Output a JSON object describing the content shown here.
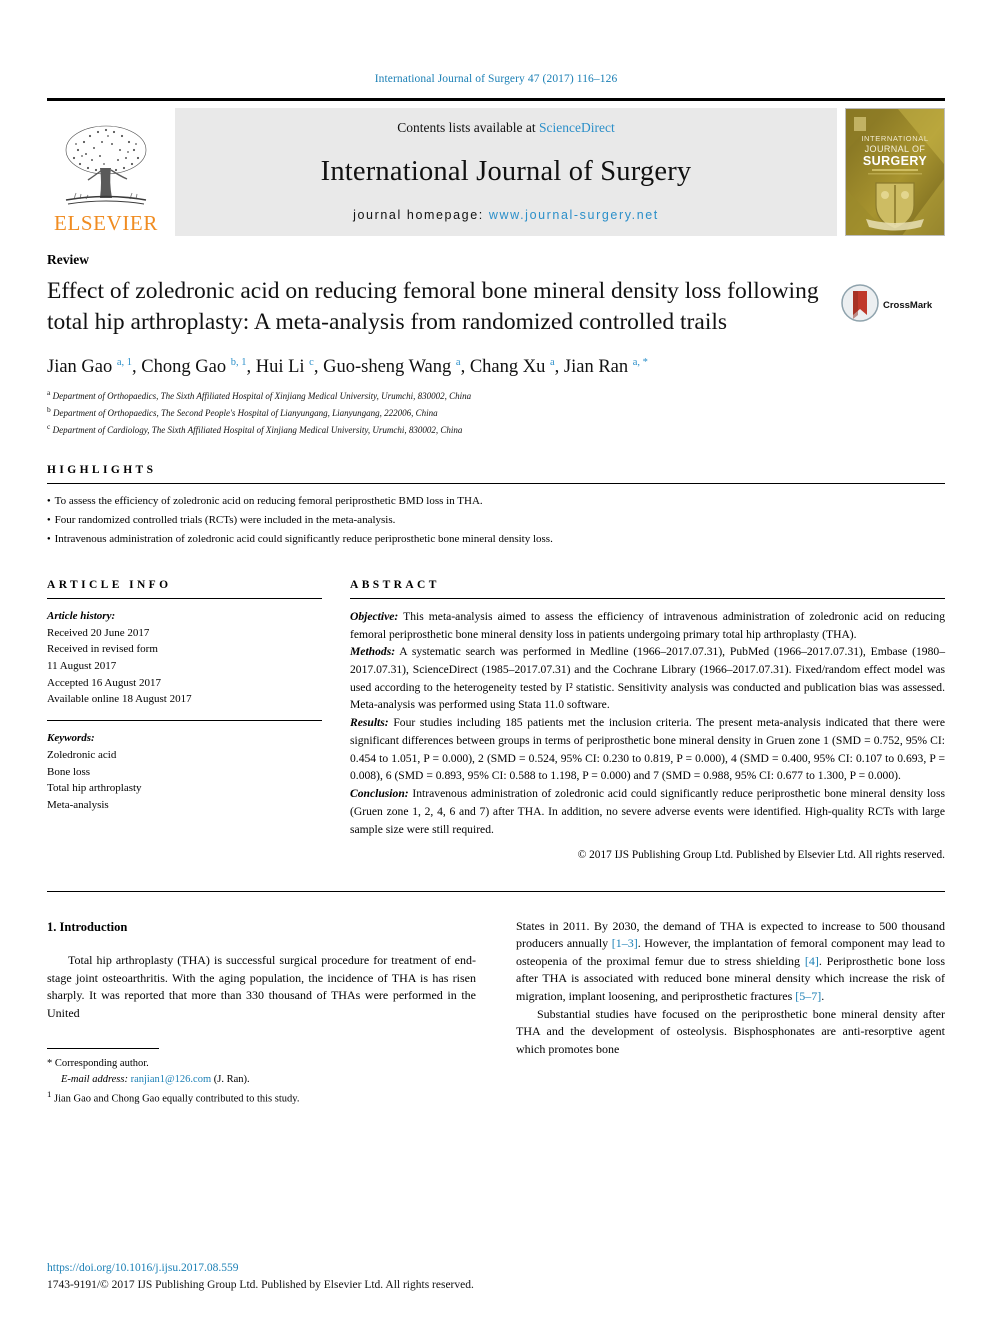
{
  "running_head": "International Journal of Surgery 47 (2017) 116–126",
  "masthead": {
    "publisher": "ELSEVIER",
    "contents_prefix": "Contents lists available at ",
    "contents_link": "ScienceDirect",
    "journal_name": "International Journal of Surgery",
    "homepage_label": "journal homepage: ",
    "homepage_url": "www.journal-surgery.net",
    "cover_line1": "INTERNATIONAL",
    "cover_line2": "JOURNAL OF",
    "cover_line3": "SURGERY"
  },
  "article": {
    "type": "Review",
    "title": "Effect of zoledronic acid on reducing femoral bone mineral density loss following total hip arthroplasty: A meta-analysis from randomized controlled trails",
    "crossmark_label": "CrossMark",
    "authors_html": "Jian Gao <sup>a, 1</sup>, Chong Gao <sup>b, 1</sup>, Hui Li <sup>c</sup>, Guo-sheng Wang <sup>a</sup>, Chang Xu <sup>a</sup>, Jian Ran <sup>a, *</sup>",
    "affiliations": [
      "a Department of Orthopaedics, The Sixth Affiliated Hospital of Xinjiang Medical University, Urumchi, 830002, China",
      "b Department of Orthopaedics, The Second People's Hospital of Lianyungang, Lianyungang, 222006, China",
      "c Department of Cardiology, The Sixth Affiliated Hospital of Xinjiang Medical University, Urumchi, 830002, China"
    ]
  },
  "highlights": {
    "heading": "HIGHLIGHTS",
    "items": [
      "To assess the efficiency of zoledronic acid on reducing femoral periprosthetic BMD loss in THA.",
      "Four randomized controlled trials (RCTs) were included in the meta-analysis.",
      "Intravenous administration of zoledronic acid could significantly reduce periprosthetic bone mineral density loss."
    ]
  },
  "article_info": {
    "heading": "ARTICLE INFO",
    "history_label": "Article history:",
    "history": [
      "Received 20 June 2017",
      "Received in revised form",
      "11 August 2017",
      "Accepted 16 August 2017",
      "Available online 18 August 2017"
    ],
    "keywords_label": "Keywords:",
    "keywords": [
      "Zoledronic acid",
      "Bone loss",
      "Total hip arthroplasty",
      "Meta-analysis"
    ]
  },
  "abstract": {
    "heading": "ABSTRACT",
    "objective_label": "Objective:",
    "objective": " This meta-analysis aimed to assess the efficiency of intravenous administration of zoledronic acid on reducing femoral periprosthetic bone mineral density loss in patients undergoing primary total hip arthroplasty (THA).",
    "methods_label": "Methods:",
    "methods": " A systematic search was performed in Medline (1966–2017.07.31), PubMed (1966–2017.07.31), Embase (1980–2017.07.31), ScienceDirect (1985–2017.07.31) and the Cochrane Library (1966–2017.07.31). Fixed/random effect model was used according to the heterogeneity tested by I² statistic. Sensitivity analysis was conducted and publication bias was assessed. Meta-analysis was performed using Stata 11.0 software.",
    "results_label": "Results:",
    "results": " Four studies including 185 patients met the inclusion criteria. The present meta-analysis indicated that there were significant differences between groups in terms of periprosthetic bone mineral density in Gruen zone 1 (SMD = 0.752, 95% CI: 0.454 to 1.051, P = 0.000), 2 (SMD = 0.524, 95% CI: 0.230 to 0.819, P = 0.000), 4 (SMD = 0.400, 95% CI: 0.107 to 0.693, P = 0.008), 6 (SMD = 0.893, 95% CI: 0.588 to 1.198, P = 0.000) and 7 (SMD = 0.988, 95% CI: 0.677 to 1.300, P = 0.000).",
    "conclusion_label": "Conclusion:",
    "conclusion": " Intravenous administration of zoledronic acid could significantly reduce periprosthetic bone mineral density loss (Gruen zone 1, 2, 4, 6 and 7) after THA. In addition, no severe adverse events were identified. High-quality RCTs with large sample size were still required.",
    "copyright": "© 2017 IJS Publishing Group Ltd. Published by Elsevier Ltd. All rights reserved."
  },
  "introduction": {
    "heading": "1. Introduction",
    "left_paragraph": "Total hip arthroplasty (THA) is successful surgical procedure for treatment of end-stage joint osteoarthritis. With the aging population, the incidence of THA is has risen sharply. It was reported that more than 330 thousand of THAs were performed in the United",
    "right_p1_a": "States in 2011. By 2030, the demand of THA is expected to increase to 500 thousand producers annually ",
    "right_p1_ref1": "[1–3]",
    "right_p1_b": ". However, the implantation of femoral component may lead to osteopenia of the proximal femur due to stress shielding ",
    "right_p1_ref2": "[4]",
    "right_p1_c": ". Periprosthetic bone loss after THA is associated with reduced bone mineral density which increase the risk of migration, implant loosening, and periprosthetic fractures ",
    "right_p1_ref3": "[5–7]",
    "right_p1_d": ".",
    "right_p2": "Substantial studies have focused on the periprosthetic bone mineral density after THA and the development of osteolysis. Bisphosphonates are anti-resorptive agent which promotes bone"
  },
  "footnotes": {
    "corresponding": "Corresponding author.",
    "email_label": "E-mail address:",
    "email": "ranjian1@126.com",
    "email_suffix": " (J. Ran).",
    "equal_contrib": "Jian Gao and Chong Gao equally contributed to this study."
  },
  "page_footer": {
    "doi": "https://doi.org/10.1016/j.ijsu.2017.08.559",
    "issn_line": "1743-9191/© 2017 IJS Publishing Group Ltd. Published by Elsevier Ltd. All rights reserved."
  },
  "colors": {
    "link_blue": "#1a7fb5",
    "sciencedirect_blue": "#2b8fc9",
    "elsevier_orange": "#f08c21",
    "cover_gold": "#8a7a2c",
    "crossmark_red": "#c0392b"
  }
}
